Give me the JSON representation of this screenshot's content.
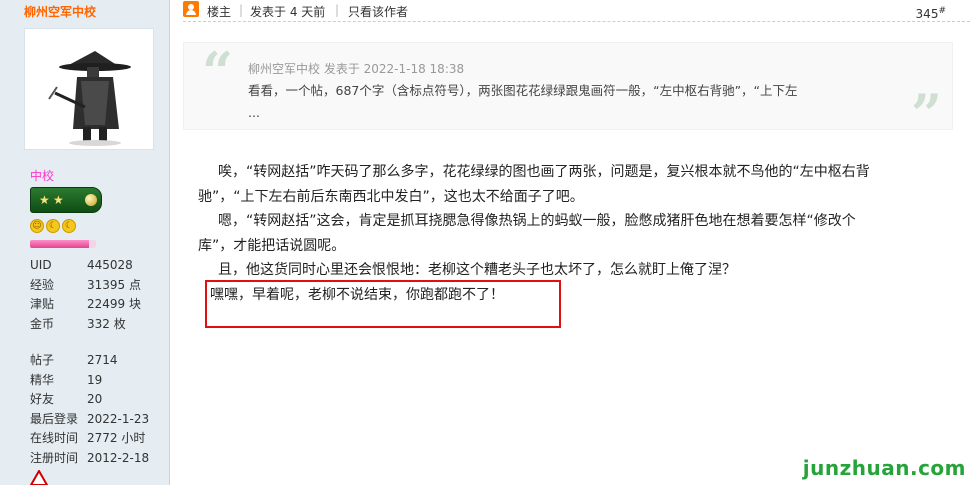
{
  "sidebar": {
    "username": "柳州空军中校",
    "rank_name": "中校",
    "exp_progress": 0.9,
    "stats_primary": [
      {
        "key": "UID",
        "value": "445028"
      },
      {
        "key": "经验",
        "value": "31395 点"
      },
      {
        "key": "津贴",
        "value": "22499 块"
      },
      {
        "key": "金币",
        "value": "332 枚"
      }
    ],
    "stats_secondary": [
      {
        "key": "帖子",
        "value": "2714"
      },
      {
        "key": "精华",
        "value": "19"
      },
      {
        "key": "好友",
        "value": "20"
      },
      {
        "key": "最后登录",
        "value": "2022-1-23"
      },
      {
        "key": "在线时间",
        "value": "2772 小时"
      },
      {
        "key": "注册时间",
        "value": "2012-2-18"
      }
    ]
  },
  "meta": {
    "host_label": "楼主",
    "posted_at": "发表于 4 天前",
    "only_author": "只看该作者",
    "floor_number": "345",
    "floor_mark": "#"
  },
  "quote": {
    "author_line": "柳州空军中校 发表于 2022-1-18 18:38",
    "text_line1": "看看，一个帖，687个字（含标点符号），两张图花花绿绿跟鬼画符一般，“左中枢右背驰”，“上下左",
    "text_line2": "..."
  },
  "post": {
    "line1": "唉，“转网赵括”咋天码了那么多字，花花绿绿的图也画了两张，问题是，复兴根本就不鸟他的“左中枢右背",
    "line2": "驰”，“上下左右前后东南西北中发白”，这也太不给面子了吧。",
    "line3": "嗯，“转网赵括”这会，肯定是抓耳挠腮急得像热锅上的蚂蚁一般，脸憋成猪肝色地在想着要怎样“修改个",
    "line4": "库”，才能把话说圆呢。",
    "line5": "且，他这货同时心里还会恨恨地：老柳这个糟老头子也太坏了，怎么就盯上俺了涅？",
    "line6": "嘿嘿，早着呢，老柳不说结束，你跑都跑不了！"
  },
  "watermark": "junzhuan.com",
  "colors": {
    "username": "#ff6600",
    "rank_name": "#ff33cc",
    "highlight_border": "#e01010",
    "watermark": "#26a43a"
  }
}
